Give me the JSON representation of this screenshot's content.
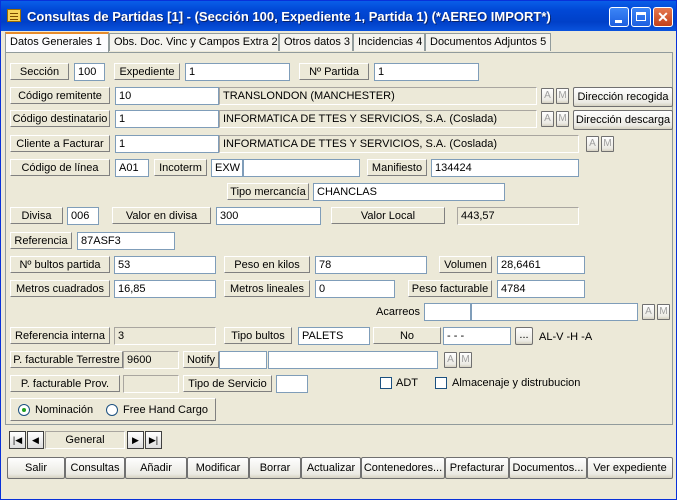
{
  "window": {
    "title": "Consultas de Partidas [1] - (Sección 100, Expediente 1, Partida 1) (*AEREO IMPORT*)",
    "close_glyph": "✕"
  },
  "tabs": [
    {
      "label": "Datos Generales 1"
    },
    {
      "label": "Obs. Doc. Vinc y Campos Extra 2"
    },
    {
      "label": "Otros datos 3"
    },
    {
      "label": "Incidencias 4"
    },
    {
      "label": "Documentos Adjuntos 5"
    }
  ],
  "form": {
    "seccion": {
      "label": "Sección",
      "value": "100"
    },
    "expediente": {
      "label": "Expediente",
      "value": "1"
    },
    "partida": {
      "label": "Nº Partida",
      "value": "1"
    },
    "remitente": {
      "label": "Código remitente",
      "code": "10",
      "name": "TRANSLONDON (MANCHESTER)",
      "btn": "Dirección recogida"
    },
    "destinatario": {
      "label": "Código destinatario",
      "code": "1",
      "name": "INFORMATICA DE TTES Y SERVICIOS, S.A. (Coslada)",
      "btn": "Dirección descarga"
    },
    "cliente": {
      "label": "Cliente a Facturar",
      "code": "1",
      "name": "INFORMATICA DE TTES Y SERVICIOS, S.A. (Coslada)"
    },
    "linea": {
      "label": "Código de línea",
      "value": "A01"
    },
    "incoterm": {
      "label": "Incoterm",
      "value": "EXW",
      "extra": ""
    },
    "manifiesto": {
      "label": "Manifiesto",
      "value": "134424"
    },
    "mercancia": {
      "label": "Tipo mercancía",
      "value": "CHANCLAS"
    },
    "divisa": {
      "label": "Divisa",
      "value": "006"
    },
    "valor_divisa": {
      "label": "Valor en divisa",
      "value": "300"
    },
    "valor_local": {
      "label": "Valor Local",
      "value": "443,57"
    },
    "referencia": {
      "label": "Referencia",
      "value": "87ASF3"
    },
    "bultos": {
      "label": "Nº bultos partida",
      "value": "53"
    },
    "peso": {
      "label": "Peso en kilos",
      "value": "78"
    },
    "volumen": {
      "label": "Volumen",
      "value": "28,6461"
    },
    "metros_cuadrados": {
      "label": "Metros cuadrados",
      "value": "16,85"
    },
    "metros_lineales": {
      "label": "Metros lineales",
      "value": "0"
    },
    "peso_facturable": {
      "label": "Peso facturable",
      "value": "4784"
    },
    "acarreos": {
      "label": "Acarreos",
      "value": ""
    },
    "ref_interna": {
      "label": "Referencia interna",
      "value": "3"
    },
    "tipo_bultos": {
      "label": "Tipo bultos",
      "value": "PALETS",
      "no_label": "No",
      "date_value": " -  -  -",
      "ellipsis": "...",
      "alvha": "AL-V -H -A"
    },
    "pf_terrestre": {
      "label": "P. facturable Terrestre",
      "value": "9600"
    },
    "notify": {
      "label": "Notify",
      "code": "",
      "name": ""
    },
    "pf_prov": {
      "label": "P. facturable Prov.",
      "value": ""
    },
    "tipo_servicio": {
      "label": "Tipo de Servicio",
      "value": ""
    },
    "adt": {
      "label": "ADT"
    },
    "almacenaje": {
      "label": "Almacenaje y distrubucion"
    },
    "nominacion": {
      "label": "Nominación"
    },
    "free_hand": {
      "label": "Free Hand Cargo"
    },
    "small_btn_a": "A",
    "small_btn_m": "M"
  },
  "navigator": {
    "label": "General",
    "first": "|◀",
    "prev": "◀",
    "next": "▶",
    "last": "▶|"
  },
  "buttons": [
    {
      "label": "Salir"
    },
    {
      "label": "Consultas"
    },
    {
      "label": "Añadir"
    },
    {
      "label": "Modificar"
    },
    {
      "label": "Borrar"
    },
    {
      "label": "Actualizar"
    },
    {
      "label": "Contenedores..."
    },
    {
      "label": "Prefacturar"
    },
    {
      "label": "Documentos..."
    },
    {
      "label": "Ver expediente"
    }
  ]
}
